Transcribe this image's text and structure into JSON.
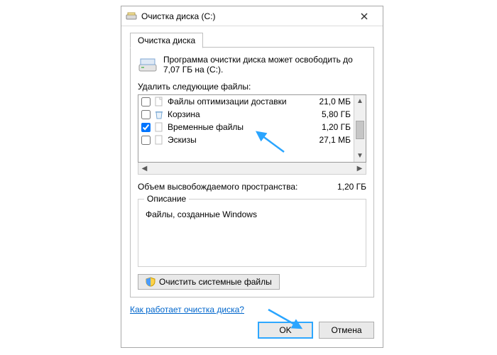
{
  "window": {
    "title": "Очистка диска (C:)"
  },
  "tab": {
    "label": "Очистка диска"
  },
  "info": "Программа очистки диска может освободить до 7,07 ГБ на (C:).",
  "files_label": "Удалить следующие файлы:",
  "files": [
    {
      "label": "Файлы оптимизации доставки",
      "size": "21,0 МБ",
      "checked": false
    },
    {
      "label": "Корзина",
      "size": "5,80 ГБ",
      "checked": false
    },
    {
      "label": "Временные файлы",
      "size": "1,20 ГБ",
      "checked": true
    },
    {
      "label": "Эскизы",
      "size": "27,1 МБ",
      "checked": false
    }
  ],
  "freed": {
    "label": "Объем высвобождаемого пространства:",
    "value": "1,20 ГБ"
  },
  "description": {
    "legend": "Описание",
    "text": "Файлы, созданные Windows"
  },
  "system_files_button": "Очистить системные файлы",
  "help_link": "Как работает очистка диска?",
  "buttons": {
    "ok": "OK",
    "cancel": "Отмена"
  }
}
